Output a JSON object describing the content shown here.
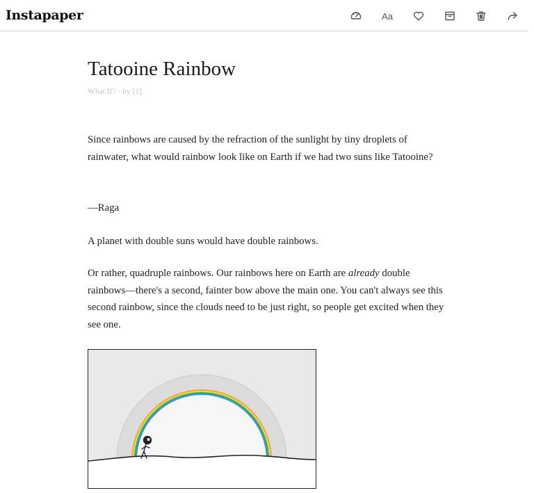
{
  "app": {
    "brand": "Instapaper"
  },
  "toolbar": {
    "font_size_label": "Aa",
    "icons": [
      "speedometer-icon",
      "font-size-icon",
      "heart-icon",
      "archive-icon",
      "trash-icon",
      "share-icon"
    ]
  },
  "article": {
    "title": "Tatooine Rainbow",
    "byline": "What If? · by [1]",
    "question": "Since rainbows are caused by the refraction of the sunlight by tiny droplets of rainwater, what would rainbow look like on Earth if we had two suns like Tatooine?",
    "signature": "—Raga",
    "answer_1": "A planet with double suns would have double rainbows.",
    "answer_2_before": "Or rather, quadruple rainbows. Our rainbows here on Earth are ",
    "answer_2_emphasis": "already",
    "answer_2_after": " double rainbows—there's a second, fainter bow above the main one. You can't always see this second rainbow, since the clouds need to be just right, so people get excited when they see one."
  },
  "colors": {
    "sky_gray": "#e9e9e9",
    "outer_bow_gray": "#dcdcdc",
    "rainbow_orange": "#f2a43a",
    "rainbow_yellow": "#e8d84a",
    "rainbow_green": "#2aa860",
    "rainbow_blue": "#3b8fd4"
  }
}
